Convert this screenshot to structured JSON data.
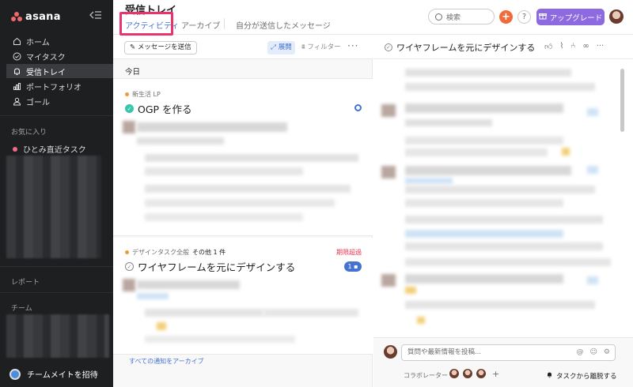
{
  "sidebar": {
    "logo": "asana",
    "nav": [
      {
        "label": "ホーム",
        "icon": "home-icon"
      },
      {
        "label": "マイタスク",
        "icon": "check-circle-icon"
      },
      {
        "label": "受信トレイ",
        "icon": "bell-icon"
      },
      {
        "label": "ポートフォリオ",
        "icon": "bar-chart-icon"
      },
      {
        "label": "ゴール",
        "icon": "person-icon"
      }
    ],
    "favorites_label": "お気に入り",
    "favorites": [
      {
        "label": "ひとみ直近タスク",
        "color": "#f06a8b"
      }
    ],
    "reports_label": "レポート",
    "teams_label": "チーム",
    "invite_label": "チームメイトを招待"
  },
  "header": {
    "title": "受信トレイ",
    "tabs": [
      "アクティビティ",
      "アーカイブ",
      "自分が送信したメッセージ"
    ],
    "search_placeholder": "検索",
    "plus": "+",
    "help": "?",
    "upgrade_label": "アップグレード"
  },
  "list": {
    "send_message_label": "メッセージを送信",
    "expand_label": "展開",
    "filter_label": "フィルター",
    "more": "···",
    "section_today": "今日",
    "cards": [
      {
        "project": "新生活 LP",
        "title": "OGP を作る",
        "completed": true
      },
      {
        "project": "デザインタスク全般",
        "project_extra": "その他 1 件",
        "title": "ワイヤフレームを元にデザインする",
        "completed": false,
        "status": "期限超過",
        "comment_count": "1"
      }
    ],
    "archive_all_label": "すべての通知をアーカイブ"
  },
  "detail": {
    "title": "ワイヤフレームを元にデザインする",
    "composer_placeholder": "質問や最新情報を投稿...",
    "collaborators_label": "コラボレーター",
    "collaborators_plus": "+",
    "leave_label": "タスクから離脱する"
  },
  "colors": {
    "accent": "#4573d2",
    "sidebar_bg": "#1e1f21",
    "brand": "#f06a6a",
    "upgrade": "#8d6ae0",
    "highlight_box": "#e8336d",
    "overdue": "#e8384f"
  }
}
